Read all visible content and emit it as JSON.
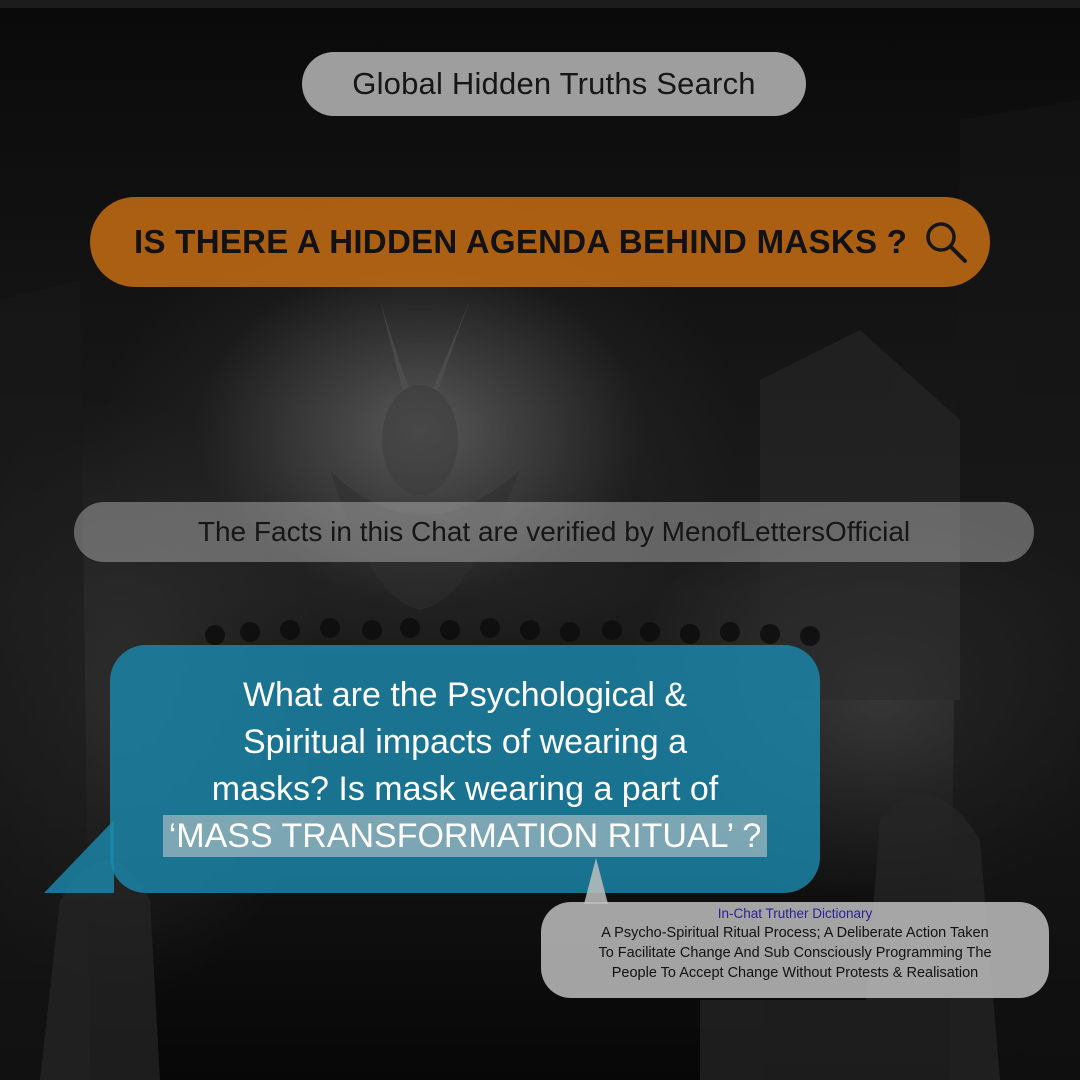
{
  "header": {
    "title": "Global Hidden Truths Search"
  },
  "search": {
    "query": "IS THERE A HIDDEN AGENDA BEHIND MASKS ?",
    "icon": "search-icon"
  },
  "verification": {
    "text": "The Facts in this Chat are verified by MenofLettersOfficial"
  },
  "question": {
    "lines": [
      "What are the Psychological &",
      "Spiritual impacts of wearing a",
      "masks? Is mask wearing a part of"
    ],
    "highlight": "‘MASS TRANSFORMATION RITUAL’ ?"
  },
  "dictionary": {
    "title": "In-Chat Truther Dictionary",
    "lines": [
      "A Psycho-Spiritual Ritual Process; A Deliberate Action Taken",
      "To Facilitate Change And Sub Consciously Programming The",
      "People To Accept Change Without Protests & Realisation"
    ]
  },
  "colors": {
    "search_bar": "#cd7014",
    "question_bubble": "#1a87ac",
    "dictionary_title": "#2a2290",
    "pill_gray": "#bebebe"
  }
}
